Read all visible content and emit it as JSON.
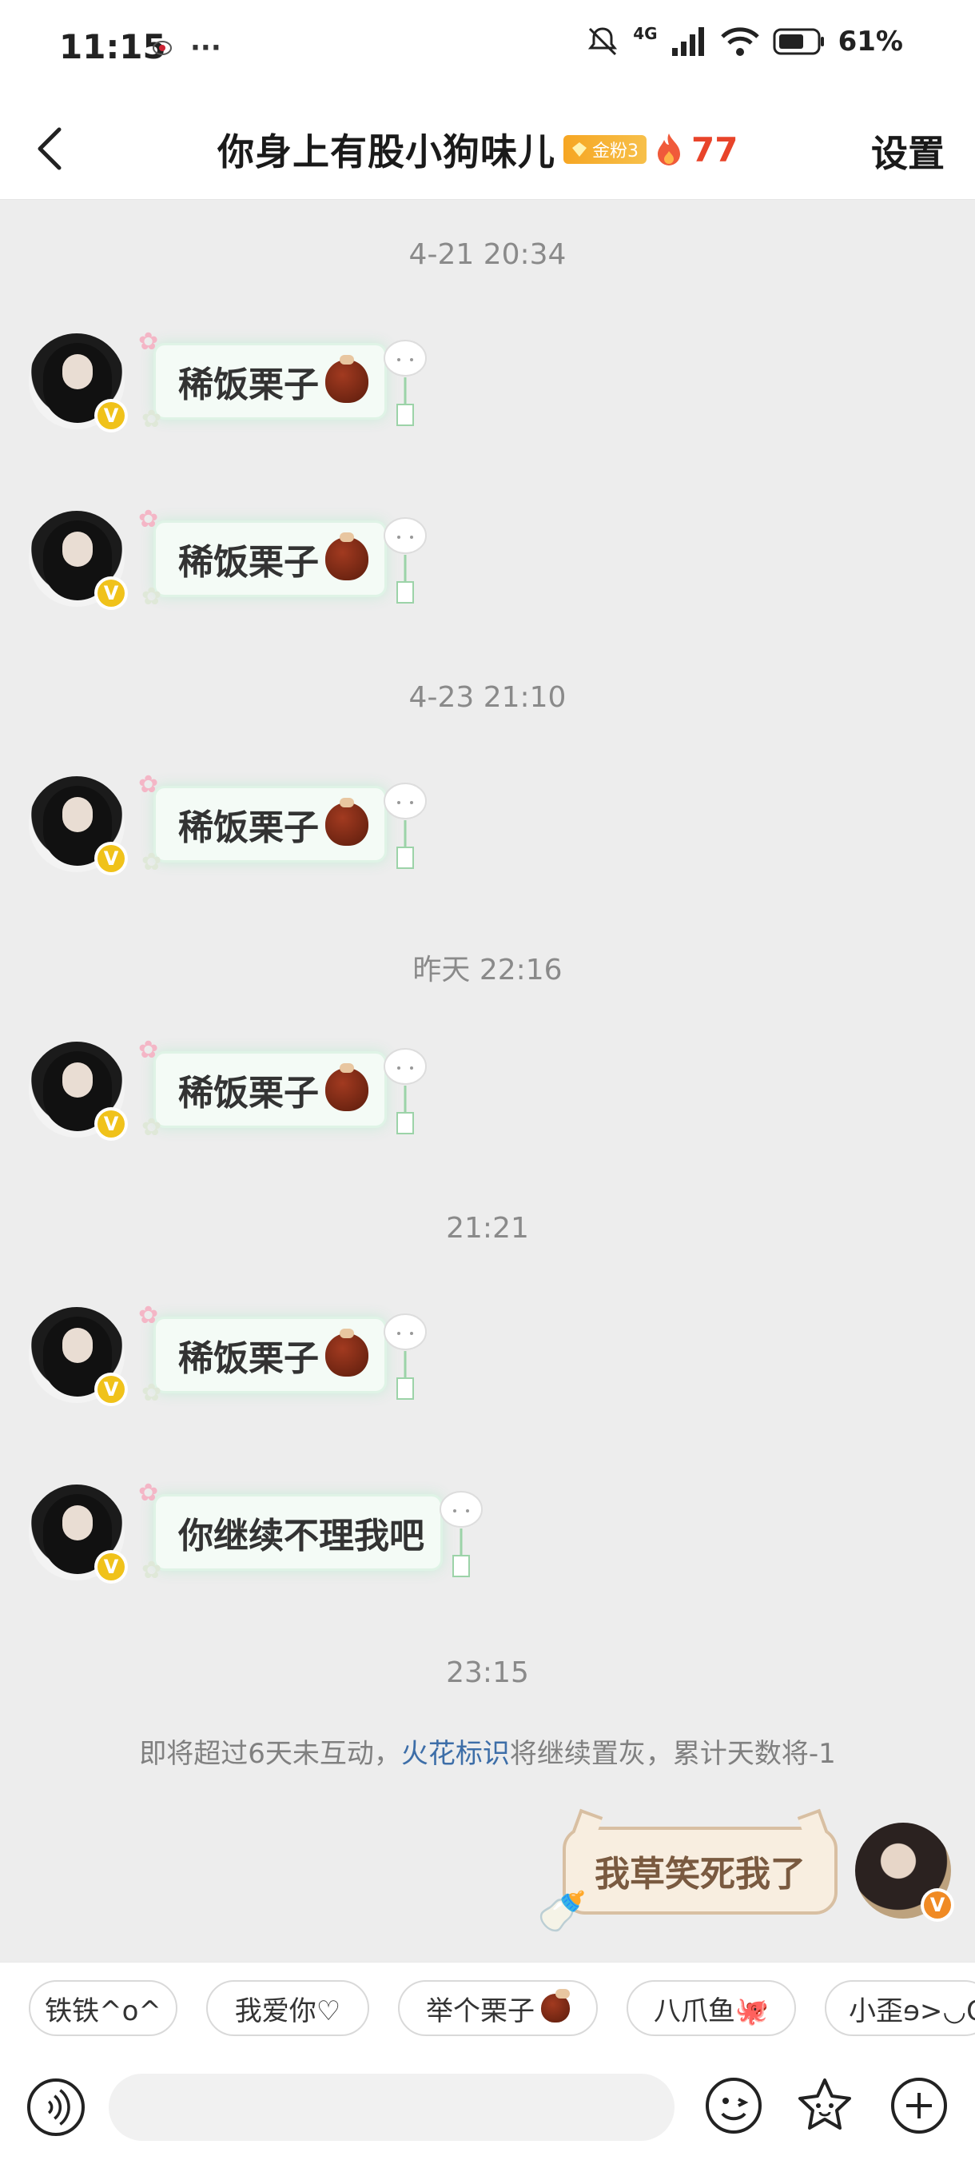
{
  "status_bar": {
    "time": "11:15",
    "ellipsis": "···",
    "network": "4G",
    "battery": "61%"
  },
  "header": {
    "title": "你身上有股小狗味儿",
    "fan_badge": "金粉3",
    "streak": "77",
    "settings": "设置"
  },
  "timestamps": [
    "4-21 20:34",
    "4-23 21:10",
    "昨天 22:16",
    "21:21",
    "23:15"
  ],
  "messages": [
    {
      "text": "稀饭栗子",
      "emoji": "chestnut"
    },
    {
      "text": "稀饭栗子",
      "emoji": "chestnut"
    },
    {
      "text": "稀饭栗子",
      "emoji": "chestnut"
    },
    {
      "text": "稀饭栗子",
      "emoji": "chestnut"
    },
    {
      "text": "稀饭栗子",
      "emoji": "chestnut"
    },
    {
      "text": "你继续不理我吧",
      "emoji": ""
    }
  ],
  "notice": {
    "before": "即将超过6天未互动，",
    "link": "火花标识",
    "after": "将继续置灰，累计天数将-1"
  },
  "self_message": {
    "text": "我草笑死我了"
  },
  "quick_replies": [
    "铁铁^o^",
    "我爱你♡",
    "举个栗子",
    "八爪鱼🐙",
    "小歪ɘ>◡O"
  ],
  "colors": {
    "streak": "#e8442a",
    "link": "#3d6ea8",
    "background": "#ededed"
  }
}
